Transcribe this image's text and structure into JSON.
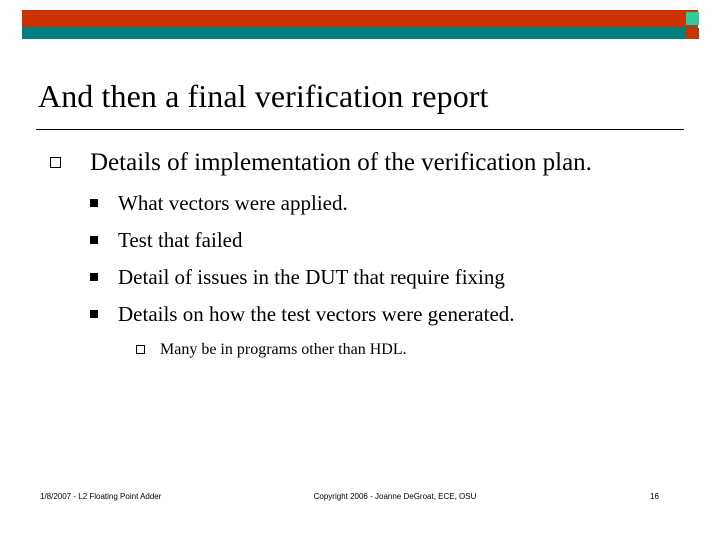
{
  "slide": {
    "title": "And then a final verification report",
    "bullets": {
      "level1": "Details of implementation of the verification plan.",
      "level2": [
        "What vectors were applied.",
        "Test that failed",
        "Detail of issues in the DUT that require fixing",
        "Details on how the test vectors were generated."
      ],
      "level3": "Many be in programs other than HDL."
    },
    "footer": {
      "left": "1/8/2007 - L2 Floating Point Adder",
      "center": "Copyright 2006 - Joanne DeGroat, ECE, OSU",
      "page_number": "16"
    },
    "colors": {
      "banner_red": "#cc3300",
      "banner_teal": "#008080",
      "banner_accent": "#33cc99",
      "text": "#000000"
    }
  }
}
